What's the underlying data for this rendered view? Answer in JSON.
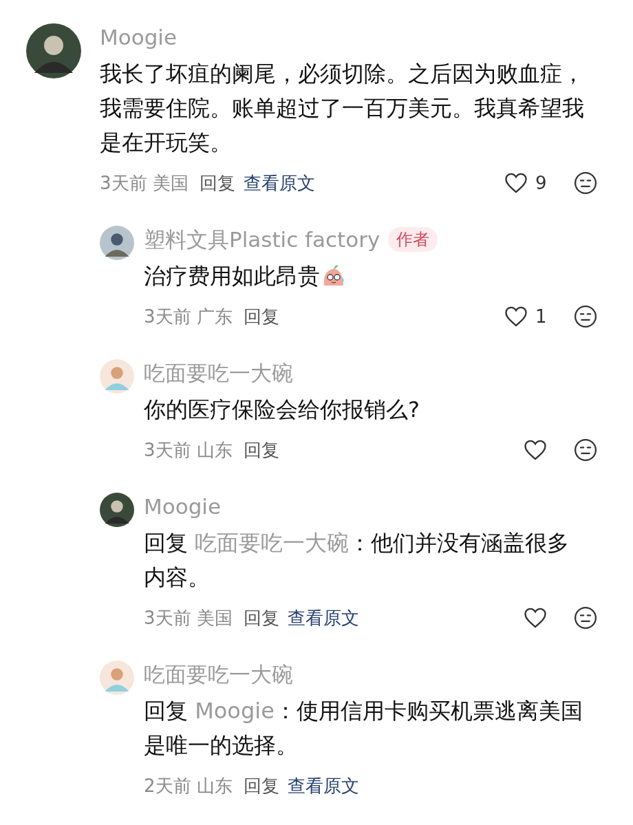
{
  "comment": {
    "name": "Moogie",
    "avatar": {
      "kind": "dark"
    },
    "text": "我长了坏疽的阑尾，必须切除。之后因为败血症，我需要住院。账单超过了一百万美元。我真希望我是在开玩笑。",
    "time": "3天前",
    "region": "美国",
    "reply_label": "回复",
    "view_original": "查看原文",
    "likes": "9",
    "actions": true,
    "replies": [
      {
        "name": "塑料文具Plastic factory",
        "avatar": {
          "kind": "photo"
        },
        "badge": "作者",
        "text": "治疗费用如此昂贵",
        "emoji": true,
        "time": "3天前",
        "region": "广东",
        "reply_label": "回复",
        "likes": "1",
        "actions": true
      },
      {
        "name": "吃面要吃一大碗",
        "avatar": {
          "kind": "mask"
        },
        "text": "你的医疗保险会给你报销么?",
        "time": "3天前",
        "region": "山东",
        "reply_label": "回复",
        "actions": true
      },
      {
        "name": "Moogie",
        "avatar": {
          "kind": "dark"
        },
        "reply_prefix": "回复",
        "reply_to": "吃面要吃一大碗",
        "text": "：他们并没有涵盖很多内容。",
        "time": "3天前",
        "region": "美国",
        "reply_label": "回复",
        "view_original": "查看原文",
        "actions": true
      },
      {
        "name": "吃面要吃一大碗",
        "avatar": {
          "kind": "mask"
        },
        "reply_prefix": "回复",
        "reply_to": "Moogie",
        "text": "：使用信用卡购买机票逃离美国是唯一的选择。",
        "time": "2天前",
        "region": "山东",
        "reply_label": "回复",
        "view_original": "查看原文",
        "actions": false
      }
    ]
  }
}
